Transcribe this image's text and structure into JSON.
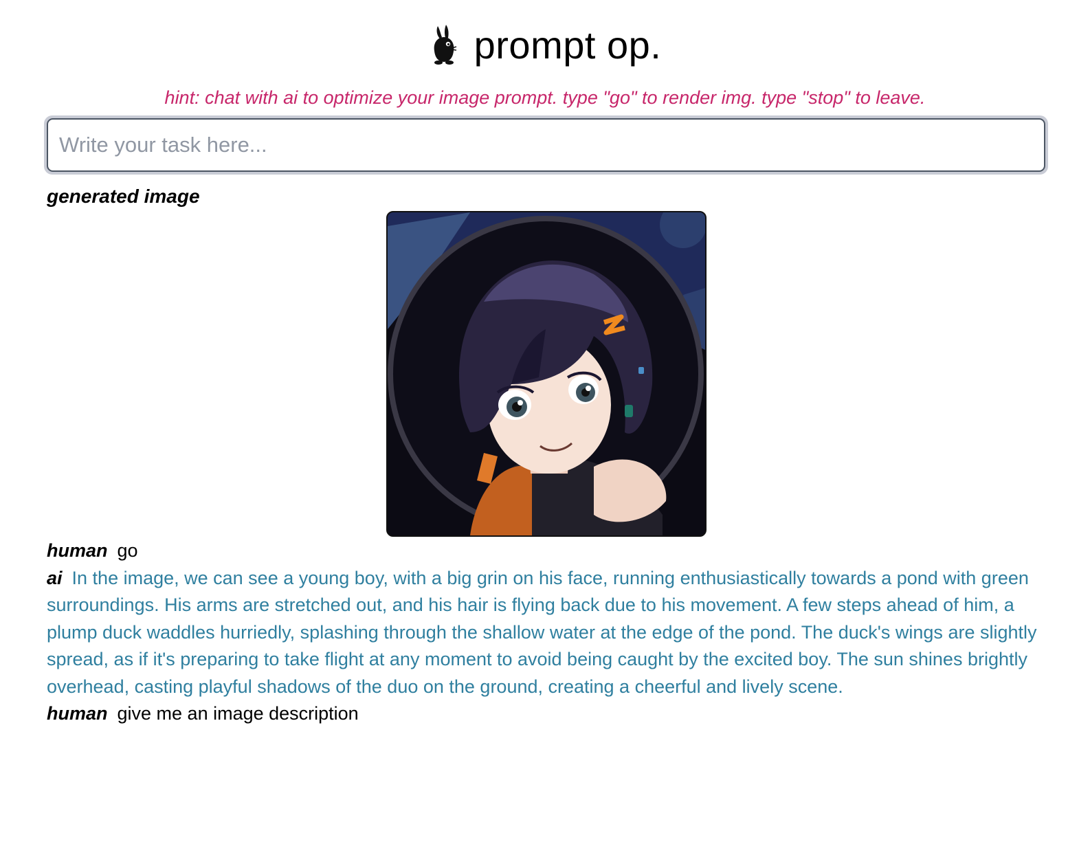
{
  "header": {
    "title": "prompt op."
  },
  "hint": "hint: chat with ai to optimize your image prompt. type \"go\" to render img. type \"stop\" to leave.",
  "task_input": {
    "placeholder": "Write your task here...",
    "value": ""
  },
  "generated_section": {
    "label": "generated image"
  },
  "chat": [
    {
      "speaker": "human",
      "text": "go"
    },
    {
      "speaker": "ai",
      "text": "In the image, we can see a young boy, with a big grin on his face, running enthusiastically towards a pond with green surroundings. His arms are stretched out, and his hair is flying back due to his movement. A few steps ahead of him, a plump duck waddles hurriedly, splashing through the shallow water at the edge of the pond. The duck's wings are slightly spread, as if it's preparing to take flight at any moment to avoid being caught by the excited boy. The sun shines brightly overhead, casting playful shadows of the duo on the ground, creating a cheerful and lively scene."
    },
    {
      "speaker": "human",
      "text": "give me an image description"
    }
  ],
  "colors": {
    "hint": "#c7266a",
    "ai_text": "#2f7f9f",
    "input_ring": "#c9ccd6",
    "input_border": "#4b5563"
  },
  "icons": {
    "logo": "rabbit-logo-icon"
  }
}
